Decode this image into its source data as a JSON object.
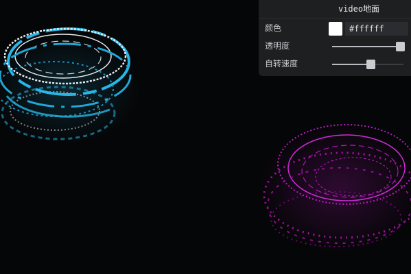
{
  "panel": {
    "title": "video地面",
    "rows": {
      "color": {
        "label": "颜色",
        "value": "#ffffff",
        "swatch": "#ffffff"
      },
      "opacity": {
        "label": "透明度",
        "value": 0.95
      },
      "speed": {
        "label": "自转速度",
        "value": 0.54
      }
    }
  },
  "scene": {
    "background": "#050607",
    "ring_colors": {
      "cyan": "#27b6e6",
      "white": "#e8ecef",
      "magenta": "#c21ac9"
    }
  }
}
